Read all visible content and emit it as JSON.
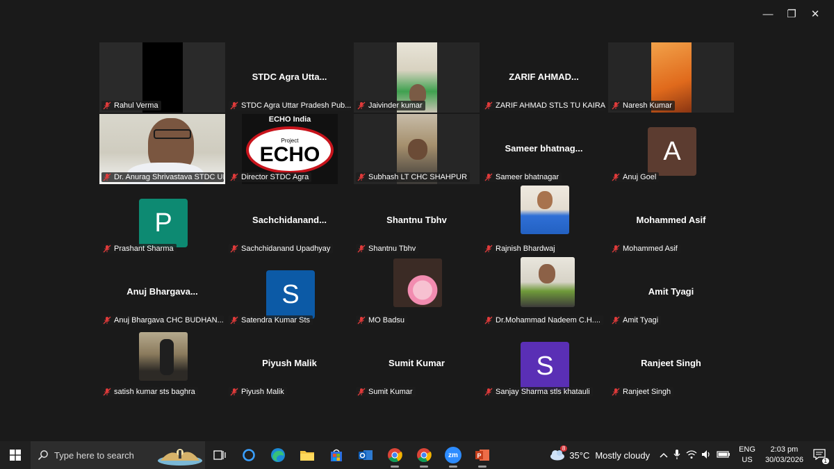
{
  "window": {
    "minimize_glyph": "—",
    "restore_glyph": "❐",
    "close_glyph": "✕"
  },
  "tiles": [
    {
      "name": "Rahul Verma",
      "kind": "video",
      "tone": "black"
    },
    {
      "name": "STDC Agra Uttar Pradesh Pub...",
      "kind": "text",
      "big": "STDC Agra Utta..."
    },
    {
      "name": "Jaivinder kumar",
      "kind": "video",
      "tone": "room"
    },
    {
      "name": "ZARIF AHMAD STLS TU KAIRA...",
      "kind": "text",
      "big": "ZARIF AHMAD..."
    },
    {
      "name": "Naresh Kumar",
      "kind": "video",
      "tone": "orange"
    },
    {
      "name": "Dr. Anurag Shrivastava STDC UP ...",
      "kind": "video",
      "tone": "face",
      "active": true
    },
    {
      "name": "Director STDC Agra",
      "kind": "echo",
      "echo_top": "ECHO India",
      "echo_small": "Project",
      "echo_word": "ECHO"
    },
    {
      "name": "Subhash LT CHC SHAHPUR",
      "kind": "video",
      "tone": "room2"
    },
    {
      "name": "Sameer bhatnagar",
      "kind": "text",
      "big": "Sameer  bhatnag..."
    },
    {
      "name": "Anuj Goel",
      "kind": "avatar",
      "letter": "A",
      "color": "#5c3c30"
    },
    {
      "name": "Prashant Sharma",
      "kind": "avatar",
      "letter": "P",
      "color": "#0d8a72"
    },
    {
      "name": "Sachchidanand Upadhyay",
      "kind": "text",
      "big": "Sachchidanand..."
    },
    {
      "name": "Shantnu Tbhv",
      "kind": "text",
      "big": "Shantnu Tbhv"
    },
    {
      "name": "Rajnish Bhardwaj",
      "kind": "photo",
      "tone": "portrait"
    },
    {
      "name": "Mohammed Asif",
      "kind": "text",
      "big": "Mohammed Asif"
    },
    {
      "name": "Anuj Bhargava  CHC BUDHAN...",
      "kind": "text",
      "big": "Anuj  Bhargava..."
    },
    {
      "name": "Satendra Kumar Sts",
      "kind": "avatar",
      "letter": "S",
      "color": "#0c5aa6"
    },
    {
      "name": "MO Badsu",
      "kind": "photo",
      "tone": "donut"
    },
    {
      "name": "Dr.Mohammad Nadeem C.H....",
      "kind": "photo",
      "tone": "portrait2"
    },
    {
      "name": "Amit Tyagi",
      "kind": "text",
      "big": "Amit Tyagi"
    },
    {
      "name": "satish kumar sts baghra",
      "kind": "photo",
      "tone": "outdoor"
    },
    {
      "name": "Piyush Malik",
      "kind": "text",
      "big": "Piyush Malik"
    },
    {
      "name": "Sumit Kumar",
      "kind": "text",
      "big": "Sumit Kumar"
    },
    {
      "name": "Sanjay Sharma stls khatauli",
      "kind": "avatar",
      "letter": "S",
      "color": "#5a2fb5"
    },
    {
      "name": "Ranjeet Singh",
      "kind": "text",
      "big": "Ranjeet Singh"
    }
  ],
  "taskbar": {
    "search_placeholder": "Type here to search",
    "zoom_label": "zm",
    "weather": {
      "temp": "35°C",
      "desc": "Mostly cloudy",
      "badge": "8"
    },
    "lang": "ENG",
    "region": "US",
    "time": "2:03 pm",
    "date": "30/03/2026",
    "notif_count": "1"
  }
}
